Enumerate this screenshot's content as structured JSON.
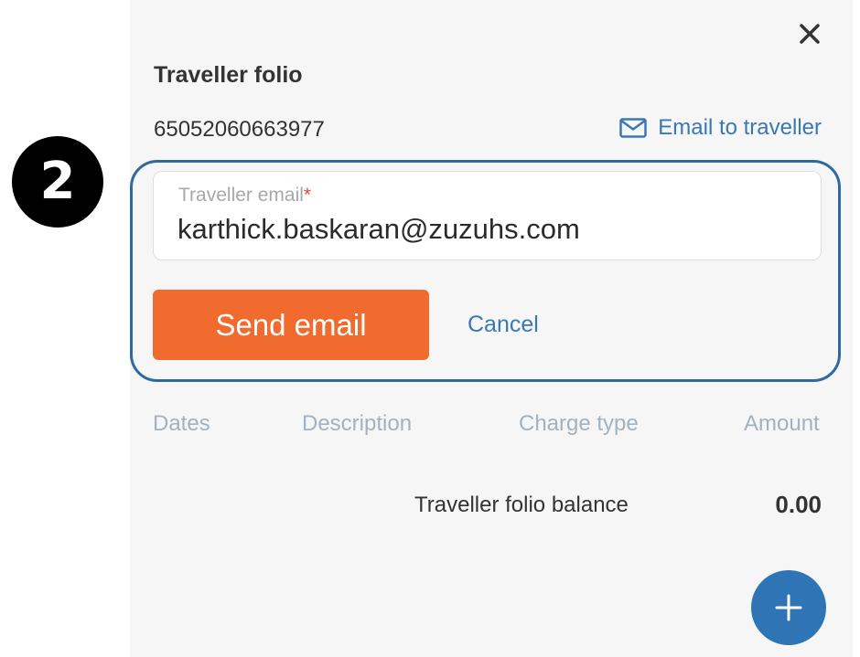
{
  "step_badge": "2",
  "panel": {
    "title": "Traveller folio",
    "folio_number": "65052060663977",
    "email_link_label": "Email to traveller"
  },
  "email_form": {
    "field_label": "Traveller email",
    "required_marker": "*",
    "field_value": "karthick.baskaran@zuzuhs.com",
    "send_label": "Send email",
    "cancel_label": "Cancel"
  },
  "table": {
    "columns": [
      "Dates",
      "Description",
      "Charge type",
      "Amount"
    ]
  },
  "balance": {
    "label": "Traveller folio balance",
    "value": "0.00"
  },
  "icons": {
    "close": "close-icon",
    "email": "envelope-icon",
    "add": "plus-icon"
  },
  "colors": {
    "accent_blue": "#3a78b5",
    "send_orange": "#f16b2e",
    "highlight_border": "#2e6a9e",
    "fab_blue": "#2f74b5"
  }
}
